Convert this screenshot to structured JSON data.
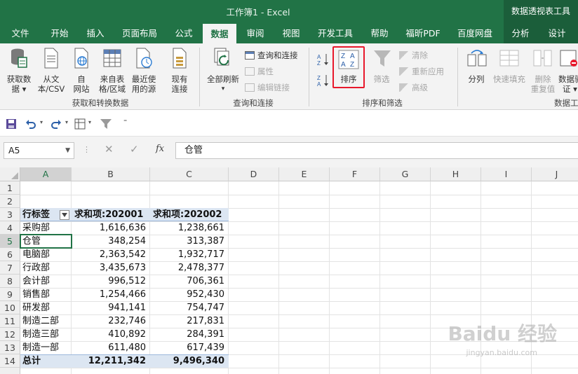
{
  "window": {
    "title": "工作簿1  -  Excel",
    "context_tab_group": "数据透视表工具"
  },
  "tabs": [
    {
      "label": "文件"
    },
    {
      "label": "开始"
    },
    {
      "label": "插入"
    },
    {
      "label": "页面布局"
    },
    {
      "label": "公式"
    },
    {
      "label": "数据",
      "active": true
    },
    {
      "label": "审阅"
    },
    {
      "label": "视图"
    },
    {
      "label": "开发工具"
    },
    {
      "label": "帮助"
    },
    {
      "label": "福昕PDF"
    },
    {
      "label": "百度网盘"
    },
    {
      "label": "分析"
    },
    {
      "label": "设计"
    }
  ],
  "ribbon": {
    "get_data": {
      "line1": "获取数",
      "line2": "据 ▾"
    },
    "from_text": {
      "line1": "从文",
      "line2": "本/CSV"
    },
    "from_web": {
      "line1": "自",
      "line2": "网站"
    },
    "from_table": {
      "line1": "来自表",
      "line2": "格/区域"
    },
    "recent_sources": {
      "line1": "最近使",
      "line2": "用的源"
    },
    "existing_conn": {
      "line1": "现有",
      "line2": "连接"
    },
    "refresh_all": {
      "line1": "全部刷新",
      "line2": "▾"
    },
    "queries_conn": "查询和连接",
    "properties": "属性",
    "edit_links": "编辑链接",
    "sort": "排序",
    "filter": "筛选",
    "clear": "清除",
    "reapply": "重新应用",
    "advanced": "高级",
    "split": "分列",
    "flash_fill": "快速填充",
    "remove_dup": {
      "line1": "删除",
      "line2": "重复值"
    },
    "data_valid": {
      "line1": "数据验",
      "line2": "证 ▾"
    },
    "groups": {
      "get_transform": "获取和转换数据",
      "query_conn": "查询和连接",
      "sort_filter": "排序和筛选",
      "data_tools": "数据工"
    }
  },
  "formula_bar": {
    "name_box": "A5",
    "value": "仓管"
  },
  "columns": [
    "A",
    "B",
    "C",
    "D",
    "E",
    "F",
    "G",
    "H",
    "I",
    "J"
  ],
  "rows": [
    "1",
    "2",
    "3",
    "4",
    "5",
    "6",
    "7",
    "8",
    "9",
    "10",
    "11",
    "12",
    "13",
    "14",
    ""
  ],
  "pivot": {
    "headers": [
      "行标签",
      "求和项:202001",
      "求和项:202002"
    ],
    "data": [
      [
        "采购部",
        "1,616,636",
        "1,238,661"
      ],
      [
        "仓管",
        "348,254",
        "313,387"
      ],
      [
        "电脑部",
        "2,363,542",
        "1,932,717"
      ],
      [
        "行政部",
        "3,435,673",
        "2,478,377"
      ],
      [
        "会计部",
        "996,512",
        "706,361"
      ],
      [
        "销售部",
        "1,254,466",
        "952,430"
      ],
      [
        "研发部",
        "941,141",
        "754,747"
      ],
      [
        "制造二部",
        "232,746",
        "217,831"
      ],
      [
        "制造三部",
        "410,892",
        "284,391"
      ],
      [
        "制造一部",
        "611,480",
        "617,439"
      ]
    ],
    "total": [
      "总计",
      "12,211,342",
      "9,496,340"
    ]
  },
  "watermark": {
    "main": "Baidu 经验",
    "sub": "jingyan.baidu.com"
  },
  "colors": {
    "excel_green": "#217346",
    "highlight_red": "#e8182b",
    "pivot_band": "#dce6f2"
  }
}
